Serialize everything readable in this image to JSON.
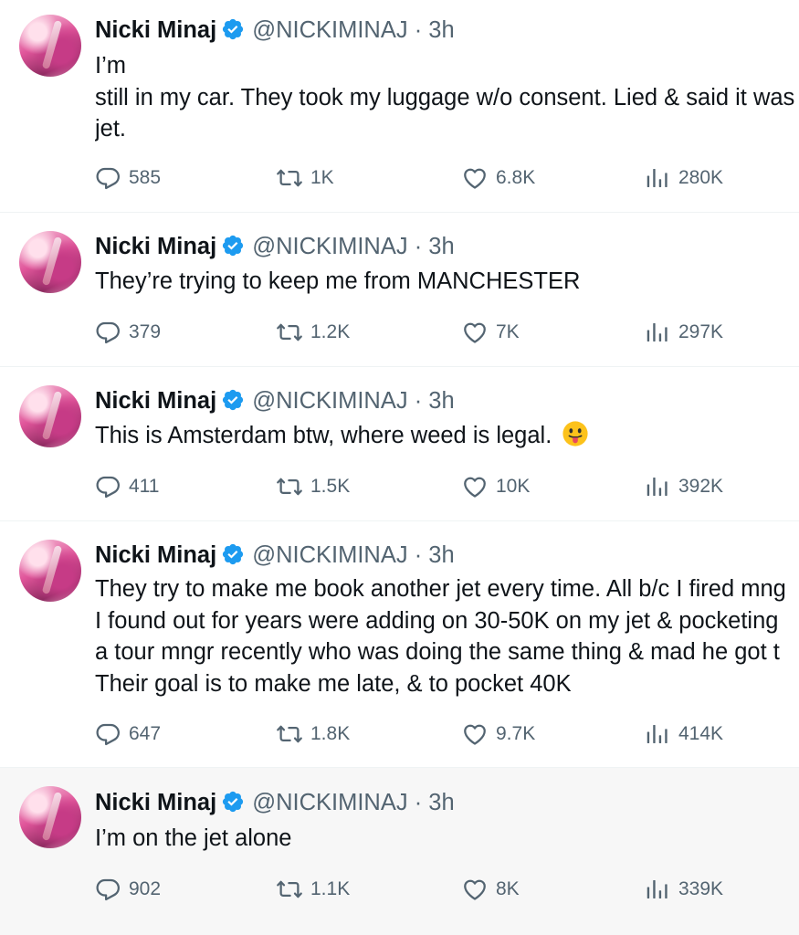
{
  "tweets": [
    {
      "name": "Nicki Minaj",
      "handle": "@NICKIMINAJ",
      "separator": "·",
      "time": "3h",
      "lines": [
        "I’m",
        "still in my car. They took my luggage w/o consent. Lied & said it was",
        "jet."
      ],
      "replies": "585",
      "retweets": "1K",
      "likes": "6.8K",
      "views": "280K"
    },
    {
      "name": "Nicki Minaj",
      "handle": "@NICKIMINAJ",
      "separator": "·",
      "time": "3h",
      "lines": [
        "They’re trying to keep me from MANCHESTER"
      ],
      "replies": "379",
      "retweets": "1.2K",
      "likes": "7K",
      "views": "297K"
    },
    {
      "name": "Nicki Minaj",
      "handle": "@NICKIMINAJ",
      "separator": "·",
      "time": "3h",
      "lines": [
        "This is Amsterdam btw, where weed is legal. "
      ],
      "emoji": "face-with-tongue",
      "replies": "411",
      "retweets": "1.5K",
      "likes": "10K",
      "views": "392K"
    },
    {
      "name": "Nicki Minaj",
      "handle": "@NICKIMINAJ",
      "separator": "·",
      "time": "3h",
      "lines": [
        "They try to make me book another jet every time. All b/c I fired mng",
        "I found out for years were adding on 30-50K on my jet & pocketing",
        "a tour mngr recently who was doing the same thing & mad he got t",
        "Their goal is to make me late, & to pocket 40K"
      ],
      "replies": "647",
      "retweets": "1.8K",
      "likes": "9.7K",
      "views": "414K"
    },
    {
      "name": "Nicki Minaj",
      "handle": "@NICKIMINAJ",
      "separator": "·",
      "time": "3h",
      "lines": [
        "I’m on the jet alone"
      ],
      "replies": "902",
      "retweets": "1.1K",
      "likes": "8K",
      "views": "339K"
    }
  ],
  "colors": {
    "verified": "#1d9bf0",
    "secondary_text": "#536471",
    "highlight_bg": "#f7f7f7"
  },
  "icons": {
    "verified": "verified-badge-icon",
    "reply": "reply-icon",
    "retweet": "retweet-icon",
    "like": "heart-icon",
    "views": "views-icon"
  }
}
